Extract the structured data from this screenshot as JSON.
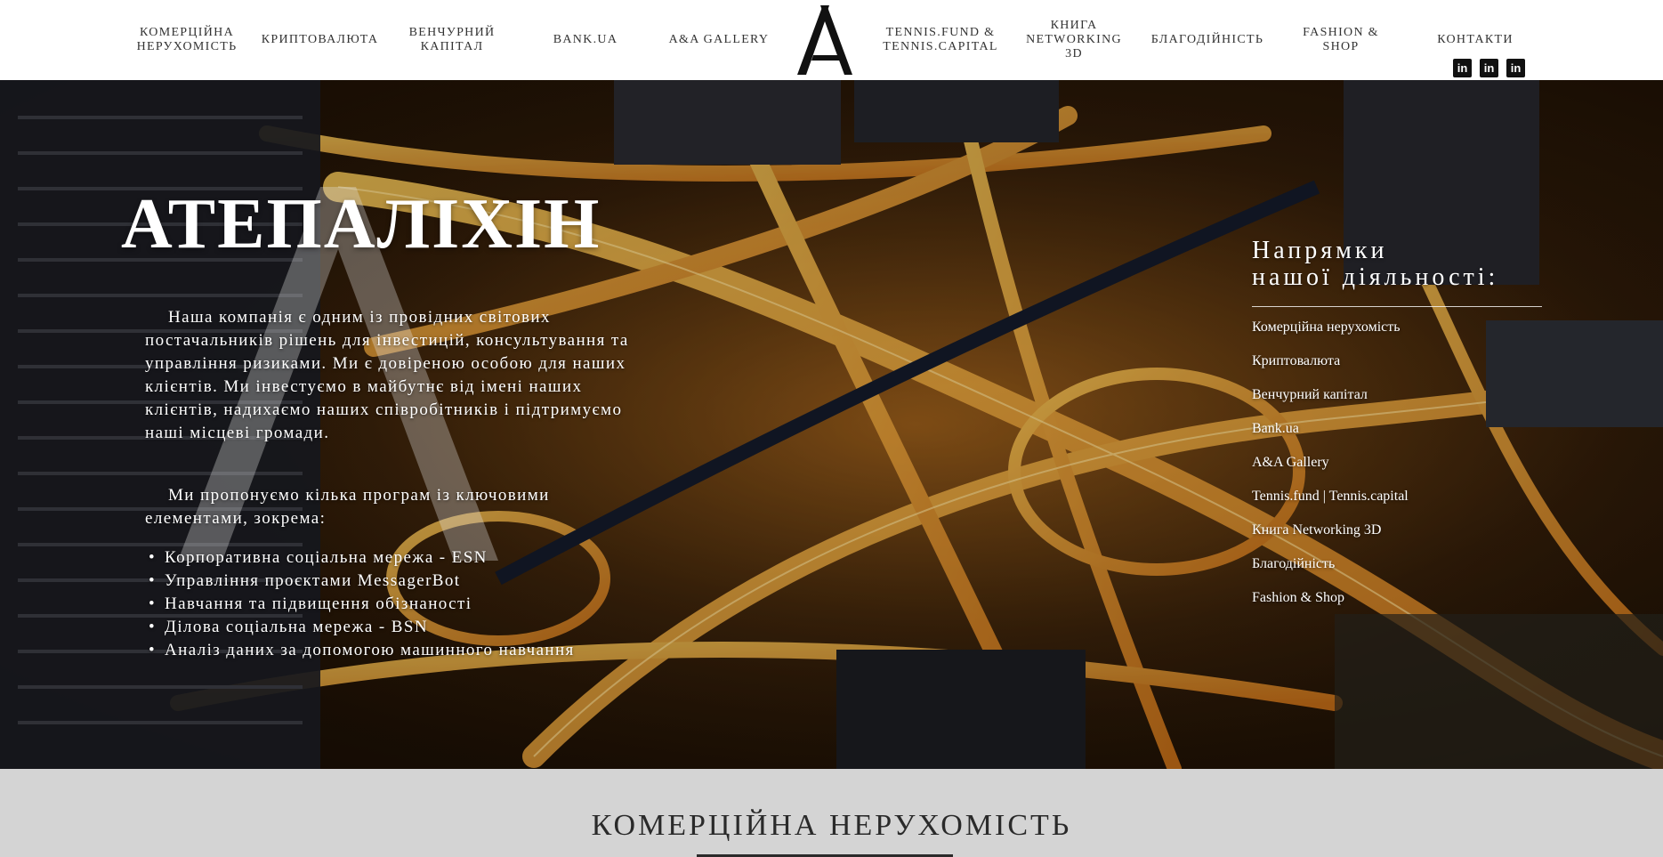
{
  "nav": {
    "items": [
      {
        "id": "nav-commercial-real-estate",
        "label_line1": "КОМЕРЦІЙНА",
        "label_line2": "НЕРУХОМІСТЬ"
      },
      {
        "id": "nav-crypto",
        "label_line1": "КРИПТОВАЛЮТА",
        "label_line2": ""
      },
      {
        "id": "nav-venture-capital",
        "label_line1": "ВЕНЧУРНИЙ",
        "label_line2": "КАПІТАЛ"
      },
      {
        "id": "nav-bank-ua",
        "label_line1": "BANK.UA",
        "label_line2": ""
      },
      {
        "id": "nav-aa-gallery",
        "label_line1": "A&A GALLERY",
        "label_line2": ""
      },
      {
        "id": "nav-tennis",
        "label_line1": "TENNIS.FUND &",
        "label_line2": "TENNIS.CAPITAL"
      },
      {
        "id": "nav-book",
        "label_line1": "КНИГА",
        "label_line2": "NETWORKING 3D"
      },
      {
        "id": "nav-charity",
        "label_line1": "БЛАГОДІЙНІСТЬ",
        "label_line2": ""
      },
      {
        "id": "nav-fashion",
        "label_line1": "FASHION & SHOP",
        "label_line2": ""
      },
      {
        "id": "nav-contacts",
        "label_line1": "КОНТАКТИ",
        "label_line2": ""
      }
    ],
    "logo_letter": "A",
    "social": [
      {
        "icon": "linkedin-icon",
        "glyph": "in"
      },
      {
        "icon": "linkedin-icon",
        "glyph": "in"
      },
      {
        "icon": "linkedin-icon",
        "glyph": "in"
      }
    ]
  },
  "hero": {
    "title": "АТЕПАЛІХІН",
    "paragraph1": "Наша компанія є одним із провідних світових постачальників рішень для інвестицій, консультування та управління ризиками. Ми є довіреною особою для наших клієнтів. Ми інвестуємо в майбутнє від імені наших клієнтів, надихаємо наших співробітників і підтримуємо наші місцеві громади.",
    "paragraph2": "Ми пропонуємо кілька програм із ключовими елементами, зокрема:",
    "bullets": [
      "Корпоративна соціальна мережа - ESN",
      "Управління проєктами MessagerBot",
      "Навчання та підвищення обізнаності",
      "Ділова соціальна мережа - BSN",
      "Аналіз даних за допомогою машинного навчання"
    ],
    "directions_title_line1": "Напрямки",
    "directions_title_line2": "нашої діяльності:",
    "directions": [
      "Комерційна нерухомість",
      "Криптовалюта",
      "Венчурний капітал",
      "Bank.ua",
      "A&A Gallery",
      "Tennis.fund | Tennis.capital",
      "Книга Networking 3D",
      "Благодійність",
      "Fashion & Shop"
    ]
  },
  "section": {
    "title": "КОМЕРЦІЙНА НЕРУХОМІСТЬ"
  },
  "colors": {
    "section_bg": "#d4d4d4",
    "hero_glow": "#f0a22a"
  }
}
